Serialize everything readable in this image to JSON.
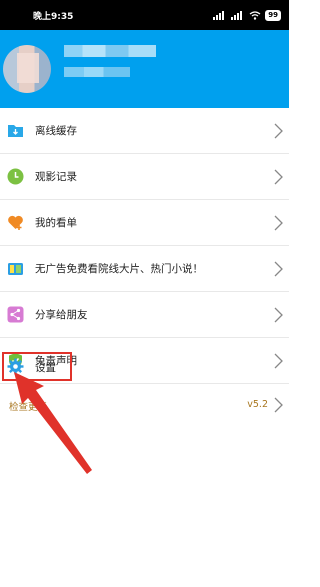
{
  "status_bar": {
    "time": "晚上9:35",
    "battery": "99"
  },
  "menu": {
    "items": [
      {
        "label": "离线缓存",
        "icon": "download-folder-icon"
      },
      {
        "label": "观影记录",
        "icon": "clock-icon"
      },
      {
        "label": "我的看单",
        "icon": "heart-plus-icon"
      },
      {
        "label": "无广告免费看院线大片、热门小说！",
        "icon": "tv-book-icon"
      },
      {
        "label": "分享给朋友",
        "icon": "share-icon"
      },
      {
        "label": "免责声明",
        "icon": "shield-check-icon"
      }
    ]
  },
  "settings": {
    "label": "设置",
    "icon": "gear-icon"
  },
  "update": {
    "label": "检查更新",
    "version": "v5.2"
  },
  "colors": {
    "header": "#00a0ee",
    "highlight": "#e0322a",
    "update_text": "#a8761f"
  }
}
